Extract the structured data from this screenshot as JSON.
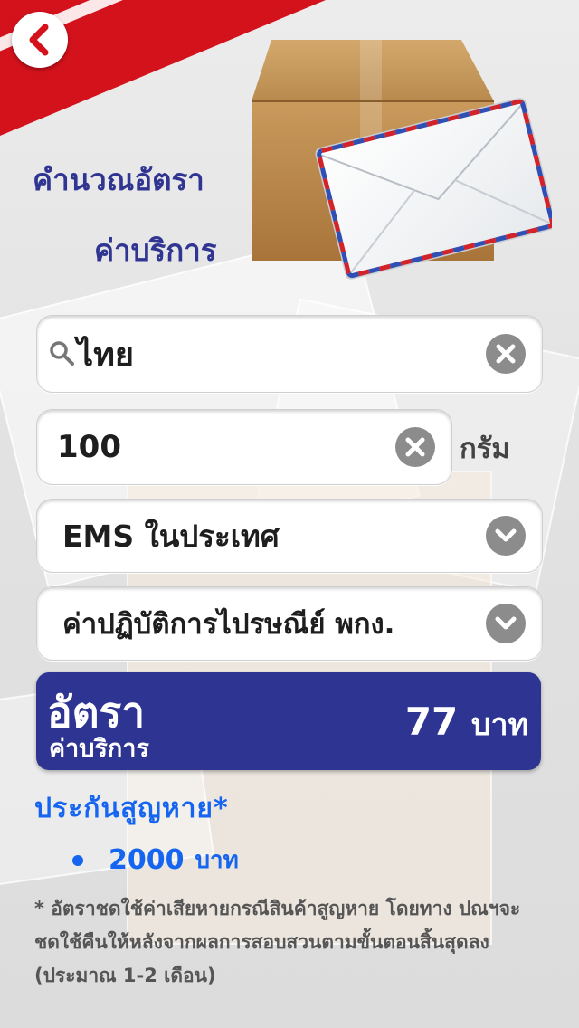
{
  "title": {
    "line1": "คำนวณอัตรา",
    "line2": "ค่าบริการ"
  },
  "destination": {
    "value": "ไทย"
  },
  "weight": {
    "value": "100",
    "unit": "กรัม"
  },
  "service": {
    "selected": "EMS ในประเทศ"
  },
  "extra": {
    "selected": "ค่าปฏิบัติการไปรษณีย์ พกง."
  },
  "result": {
    "label_line1": "อัตรา",
    "label_line2": "ค่าบริการ",
    "amount": "77",
    "currency": "บาท"
  },
  "insurance": {
    "heading": "ประกันสูญหาย*",
    "amount": "2000",
    "currency": "บาท"
  },
  "note": "* อัตราชดใช้ค่าเสียหายกรณีสินค้าสูญหาย โดยทาง ปณฯจะชดใช้คืนให้หลังจากผลการสอบสวนตามขั้นตอนสิ้นสุดลง (ประมาณ 1-2 เดือน)",
  "colors": {
    "brand_red": "#d3121c",
    "brand_blue": "#2d3492",
    "link_blue": "#1565f0"
  },
  "icons": [
    "back-chevron-icon",
    "search-icon",
    "clear-icon",
    "chevron-down-icon",
    "parcel-envelope-illustration"
  ]
}
